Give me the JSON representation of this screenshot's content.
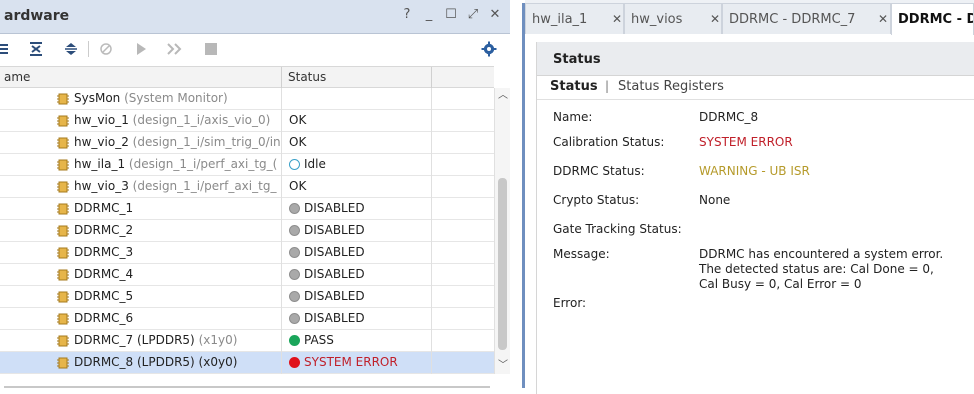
{
  "hardware": {
    "title": "ardware",
    "window_controls": [
      "?",
      "_",
      "☐",
      "⤢",
      "✕"
    ],
    "columns": {
      "name": "ame",
      "status": "Status"
    },
    "rows": [
      {
        "name": "SysMon",
        "sub": "(System Monitor)",
        "status": "",
        "dot": ""
      },
      {
        "name": "hw_vio_1",
        "sub": "(design_1_i/axis_vio_0)",
        "status": "OK",
        "dot": ""
      },
      {
        "name": "hw_vio_2",
        "sub": "(design_1_i/sim_trig_0/in",
        "status": "OK",
        "dot": ""
      },
      {
        "name": "hw_ila_1",
        "sub": "(design_1_i/perf_axi_tg_(",
        "status": "Idle",
        "dot": "idle"
      },
      {
        "name": "hw_vio_3",
        "sub": "(design_1_i/perf_axi_tg_",
        "status": "OK",
        "dot": ""
      },
      {
        "name": "DDRMC_1",
        "sub": "",
        "status": "DISABLED",
        "dot": "disabled"
      },
      {
        "name": "DDRMC_2",
        "sub": "",
        "status": "DISABLED",
        "dot": "disabled"
      },
      {
        "name": "DDRMC_3",
        "sub": "",
        "status": "DISABLED",
        "dot": "disabled"
      },
      {
        "name": "DDRMC_4",
        "sub": "",
        "status": "DISABLED",
        "dot": "disabled"
      },
      {
        "name": "DDRMC_5",
        "sub": "",
        "status": "DISABLED",
        "dot": "disabled"
      },
      {
        "name": "DDRMC_6",
        "sub": "",
        "status": "DISABLED",
        "dot": "disabled"
      },
      {
        "name": "DDRMC_7 (LPDDR5)",
        "sub": "(x1y0)",
        "status": "PASS",
        "dot": "pass"
      },
      {
        "name": "DDRMC_8 (LPDDR5) (x0y0)",
        "sub": "",
        "status": "SYSTEM ERROR",
        "dot": "error",
        "selected": true
      }
    ],
    "toolbar_icons": [
      "collapse-all-icon",
      "expand-all-icon",
      "sort-icon",
      "auto-trigger-icon",
      "run-trigger-icon",
      "run-immediate-icon",
      "stop-trigger-icon",
      "settings-gear-icon"
    ]
  },
  "tabs": [
    {
      "label": "hw_ila_1",
      "close": "✕"
    },
    {
      "label": "hw_vios",
      "close": "✕"
    },
    {
      "label": "DDRMC - DDRMC_7",
      "close": "✕"
    },
    {
      "label": "DDRMC - DD",
      "close": ""
    }
  ],
  "status_panel": {
    "title": "Status",
    "subtabs": {
      "active": "Status",
      "separator": "|",
      "other": "Status Registers"
    },
    "properties": [
      {
        "label": "Name:",
        "value": "DDRMC_8",
        "kind": "normal"
      },
      {
        "label": "Calibration Status:",
        "value": "SYSTEM ERROR",
        "kind": "error"
      },
      {
        "label": "DDRMC Status:",
        "value": "WARNING - UB ISR",
        "kind": "warn"
      },
      {
        "label": "Crypto Status:",
        "value": "None",
        "kind": "normal"
      },
      {
        "label": "Gate Tracking Status:",
        "value": "",
        "kind": "normal"
      }
    ],
    "message": {
      "label": "Message:",
      "lines": [
        "DDRMC has encountered a system error.",
        "The detected status are: Cal Done = 0,",
        "Cal Busy = 0, Cal Error = 0"
      ]
    },
    "error": {
      "label": "Error:",
      "value": ""
    }
  },
  "colors": {
    "error": "#c0202a",
    "warn": "#b59a2a",
    "pass": "#1aa55a",
    "disabled": "#a9a9a9",
    "idle_ring": "#3aa0c8",
    "selection": "#cfdff7",
    "accent": "#6f8fbf"
  }
}
